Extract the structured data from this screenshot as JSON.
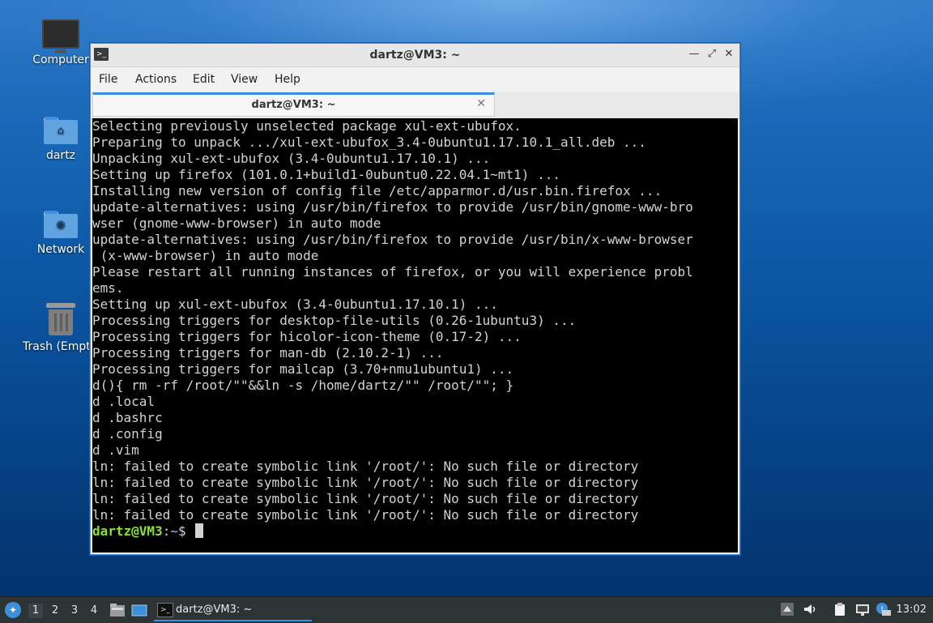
{
  "desktop": {
    "icons": [
      {
        "label": "Computer"
      },
      {
        "label": "dartz"
      },
      {
        "label": "Network"
      },
      {
        "label": "Trash (Empty)"
      }
    ]
  },
  "window": {
    "title": "dartz@VM3: ~",
    "menu": [
      "File",
      "Actions",
      "Edit",
      "View",
      "Help"
    ],
    "tab_label": "dartz@VM3: ~",
    "tab_close": "✕",
    "controls": {
      "minimize": "—",
      "restore": "⤢",
      "close": "✕"
    }
  },
  "terminal": {
    "lines": [
      "Selecting previously unselected package xul-ext-ubufox.",
      "Preparing to unpack .../xul-ext-ubufox_3.4-0ubuntu1.17.10.1_all.deb ...",
      "Unpacking xul-ext-ubufox (3.4-0ubuntu1.17.10.1) ...",
      "Setting up firefox (101.0.1+build1-0ubuntu0.22.04.1~mt1) ...",
      "Installing new version of config file /etc/apparmor.d/usr.bin.firefox ...",
      "update-alternatives: using /usr/bin/firefox to provide /usr/bin/gnome-www-bro",
      "wser (gnome-www-browser) in auto mode",
      "update-alternatives: using /usr/bin/firefox to provide /usr/bin/x-www-browser",
      " (x-www-browser) in auto mode",
      "Please restart all running instances of firefox, or you will experience probl",
      "ems.",
      "Setting up xul-ext-ubufox (3.4-0ubuntu1.17.10.1) ...",
      "Processing triggers for desktop-file-utils (0.26-1ubuntu3) ...",
      "Processing triggers for hicolor-icon-theme (0.17-2) ...",
      "Processing triggers for man-db (2.10.2-1) ...",
      "Processing triggers for mailcap (3.70+nmu1ubuntu1) ...",
      "d(){ rm -rf /root/\"\"&&ln -s /home/dartz/\"\" /root/\"\"; }",
      "d .local",
      "d .bashrc",
      "d .config",
      "d .vim",
      "ln: failed to create symbolic link '/root/': No such file or directory",
      "ln: failed to create symbolic link '/root/': No such file or directory",
      "ln: failed to create symbolic link '/root/': No such file or directory",
      "ln: failed to create symbolic link '/root/': No such file or directory"
    ],
    "prompt": {
      "user": "dartz@VM3",
      "sep": ":",
      "path": "~",
      "symbol": "$ "
    }
  },
  "taskbar": {
    "workspaces": [
      "1",
      "2",
      "3",
      "4"
    ],
    "active_workspace": "1",
    "task_label": "dartz@VM3: ~",
    "clock": "13:02",
    "tray_icons": [
      "up-arrow-icon",
      "volume-icon",
      "clipboard-icon",
      "network-icon",
      "update-notifier-icon"
    ]
  }
}
